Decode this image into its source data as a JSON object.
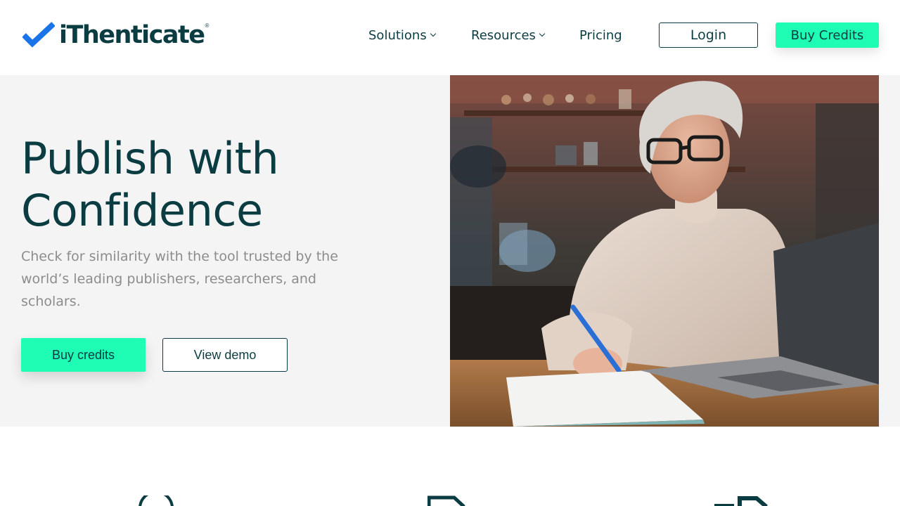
{
  "brand": {
    "name": "iThenticate",
    "registered_mark": "®",
    "accent_color": "#1ffcb4",
    "primary_color": "#0b3c42",
    "check_color": "#1a73e8"
  },
  "nav": {
    "items": [
      {
        "label": "Solutions",
        "has_dropdown": true
      },
      {
        "label": "Resources",
        "has_dropdown": true
      },
      {
        "label": "Pricing",
        "has_dropdown": false
      }
    ],
    "login_label": "Login",
    "buy_credits_label": "Buy Credits"
  },
  "hero": {
    "title_line1": "Publish with",
    "title_line2": "Confidence",
    "subtitle": "Check for similarity with the tool trusted by the world’s leading publishers, researchers, and scholars.",
    "primary_button": "Buy credits",
    "secondary_button": "View demo"
  },
  "features": {
    "icons": [
      "circle-icon",
      "document-icon",
      "document-arrow-icon"
    ]
  }
}
